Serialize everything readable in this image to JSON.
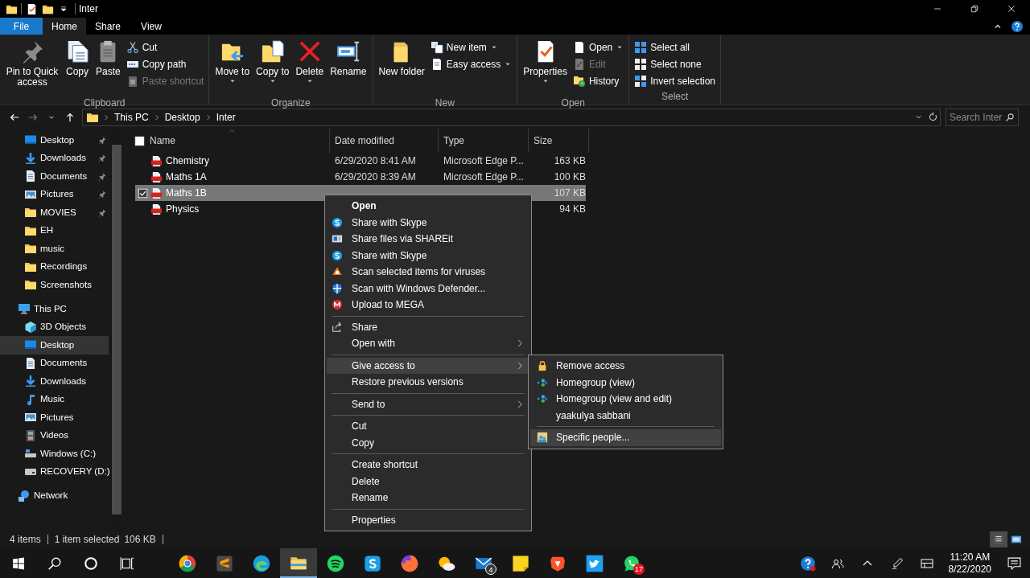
{
  "title_bar": {
    "title": "Inter",
    "quick_access": [
      {
        "kind": "folder"
      },
      {
        "kind": "properties"
      },
      {
        "kind": "folder"
      },
      {
        "kind": "dropdown"
      }
    ],
    "window_controls": [
      {
        "kind": "minimize"
      },
      {
        "kind": "restore"
      },
      {
        "kind": "close"
      }
    ]
  },
  "ribbon_tabs": [
    {
      "label": "File",
      "kind": "file",
      "selected": false
    },
    {
      "label": "Home",
      "kind": "tab",
      "selected": true
    },
    {
      "label": "Share",
      "kind": "tab",
      "selected": false
    },
    {
      "label": "View",
      "kind": "tab",
      "selected": false
    }
  ],
  "ribbon_controls": [
    {
      "kind": "collapse"
    },
    {
      "kind": "help"
    }
  ],
  "ribbon_groups": [
    {
      "label": "Clipboard",
      "commands": [
        {
          "label": "Pin to Quick access",
          "kind": "large",
          "dropdown": false,
          "disabled": false
        },
        {
          "label": "Copy",
          "kind": "large",
          "dropdown": false,
          "disabled": false
        },
        {
          "label": "Paste",
          "kind": "large",
          "dropdown": false,
          "disabled": false
        },
        {
          "label": "Cut",
          "kind": "small",
          "dropdown": false,
          "disabled": false
        },
        {
          "label": "Copy path",
          "kind": "small",
          "dropdown": false,
          "disabled": false
        },
        {
          "label": "Paste shortcut",
          "kind": "small",
          "dropdown": false,
          "disabled": true
        }
      ]
    },
    {
      "label": "Organize",
      "commands": [
        {
          "label": "Move to",
          "kind": "large",
          "dropdown": true,
          "disabled": false
        },
        {
          "label": "Copy to",
          "kind": "large",
          "dropdown": true,
          "disabled": false
        },
        {
          "label": "Delete",
          "kind": "large",
          "dropdown": true,
          "disabled": false
        },
        {
          "label": "Rename",
          "kind": "large",
          "dropdown": false,
          "disabled": false
        }
      ]
    },
    {
      "label": "New",
      "commands": [
        {
          "label": "New folder",
          "kind": "large",
          "dropdown": false,
          "disabled": false
        },
        {
          "label": "New item",
          "kind": "small",
          "dropdown": true,
          "disabled": false
        },
        {
          "label": "Easy access",
          "kind": "small",
          "dropdown": true,
          "disabled": false
        }
      ]
    },
    {
      "label": "Open",
      "commands": [
        {
          "label": "Properties",
          "kind": "large",
          "dropdown": true,
          "disabled": false
        },
        {
          "label": "Open",
          "kind": "small",
          "dropdown": true,
          "disabled": false
        },
        {
          "label": "Edit",
          "kind": "small",
          "dropdown": false,
          "disabled": true
        },
        {
          "label": "History",
          "kind": "small",
          "dropdown": false,
          "disabled": false
        }
      ]
    },
    {
      "label": "Select",
      "commands": [
        {
          "label": "Select all",
          "kind": "small",
          "dropdown": false,
          "disabled": false
        },
        {
          "label": "Select none",
          "kind": "small",
          "dropdown": false,
          "disabled": false
        },
        {
          "label": "Invert selection",
          "kind": "small",
          "dropdown": false,
          "disabled": false
        }
      ]
    }
  ],
  "navigation": {
    "buttons": [
      {
        "kind": "back",
        "disabled": false
      },
      {
        "kind": "forward",
        "disabled": true
      },
      {
        "kind": "recent",
        "disabled": false
      },
      {
        "kind": "up",
        "disabled": false
      }
    ],
    "path": [
      "This PC",
      "Desktop",
      "Inter"
    ],
    "search": {
      "placeholder": "Search Inter"
    }
  },
  "sidebar": {
    "quick_access_items": [
      {
        "label": "Desktop",
        "kind": "desktop",
        "pinned": true,
        "selected": false
      },
      {
        "label": "Downloads",
        "kind": "download",
        "pinned": true,
        "selected": false
      },
      {
        "label": "Documents",
        "kind": "documents",
        "pinned": true,
        "selected": false
      },
      {
        "label": "Pictures",
        "kind": "pictures",
        "pinned": true,
        "selected": false
      },
      {
        "label": "MOVIES",
        "kind": "folder",
        "pinned": true,
        "selected": false
      },
      {
        "label": "EH",
        "kind": "folder",
        "pinned": false,
        "selected": false
      },
      {
        "label": "music",
        "kind": "folder",
        "pinned": false,
        "selected": false
      },
      {
        "label": "Recordings",
        "kind": "folder",
        "pinned": false,
        "selected": false
      },
      {
        "label": "Screenshots",
        "kind": "folder",
        "pinned": false,
        "selected": false
      }
    ],
    "tree": [
      {
        "label": "This PC",
        "kind": "pc",
        "selected": false,
        "children": [
          {
            "label": "3D Objects",
            "kind": "cube",
            "selected": false
          },
          {
            "label": "Desktop",
            "kind": "desktop",
            "selected": true
          },
          {
            "label": "Documents",
            "kind": "documents",
            "selected": false
          },
          {
            "label": "Downloads",
            "kind": "download",
            "selected": false
          },
          {
            "label": "Music",
            "kind": "music",
            "selected": false
          },
          {
            "label": "Pictures",
            "kind": "pictures",
            "selected": false
          },
          {
            "label": "Videos",
            "kind": "videos",
            "selected": false
          },
          {
            "label": "Windows (C:)",
            "kind": "drivec",
            "selected": false
          },
          {
            "label": "RECOVERY (D:)",
            "kind": "drive",
            "selected": false
          }
        ]
      },
      {
        "label": "Network",
        "kind": "network",
        "selected": false
      }
    ]
  },
  "file_list": {
    "header_checkbox": {
      "checked": false
    },
    "columns": [
      "Name",
      "Date modified",
      "Type",
      "Size"
    ],
    "rows": [
      {
        "name": "Chemistry",
        "date": "6/29/2020 8:41 AM",
        "type": "Microsoft Edge P...",
        "size": "163 KB",
        "selected": false,
        "checked": false
      },
      {
        "name": "Maths 1A",
        "date": "6/29/2020 8:39 AM",
        "type": "Microsoft Edge P...",
        "size": "100 KB",
        "selected": false,
        "checked": false
      },
      {
        "name": "Maths 1B",
        "size": "107 KB",
        "selected": true,
        "checked": true
      },
      {
        "name": "Physics",
        "size": "94 KB",
        "selected": false,
        "checked": false
      }
    ]
  },
  "context_menu": {
    "groups": [
      [
        {
          "label": "Open",
          "kind": "plain",
          "default": true,
          "submenu": false,
          "selected": false
        },
        {
          "label": "Share with Skype",
          "kind": "skype",
          "default": false,
          "submenu": false,
          "selected": false
        },
        {
          "label": "Share files via SHAREit",
          "kind": "shareit",
          "default": false,
          "submenu": false,
          "selected": false
        },
        {
          "label": "Share with Skype",
          "kind": "skype",
          "default": false,
          "submenu": false,
          "selected": false
        },
        {
          "label": "Scan selected items for viruses",
          "kind": "avast",
          "default": false,
          "submenu": false,
          "selected": false
        },
        {
          "label": "Scan with Windows Defender...",
          "kind": "defender",
          "default": false,
          "submenu": false,
          "selected": false
        },
        {
          "label": "Upload to MEGA",
          "kind": "mega",
          "default": false,
          "submenu": false,
          "selected": false
        }
      ],
      [
        {
          "label": "Share",
          "kind": "share",
          "default": false,
          "submenu": false,
          "selected": false
        },
        {
          "label": "Open with",
          "kind": "plain",
          "default": false,
          "submenu": true,
          "selected": false
        }
      ],
      [
        {
          "label": "Give access to",
          "kind": "plain",
          "default": false,
          "submenu": true,
          "selected": true
        },
        {
          "label": "Restore previous versions",
          "kind": "plain",
          "default": false,
          "submenu": false,
          "selected": false
        }
      ],
      [
        {
          "label": "Send to",
          "kind": "plain",
          "default": false,
          "submenu": true,
          "selected": false
        }
      ],
      [
        {
          "label": "Cut",
          "kind": "plain",
          "default": false,
          "submenu": false,
          "selected": false
        },
        {
          "label": "Copy",
          "kind": "plain",
          "default": false,
          "submenu": false,
          "selected": false
        }
      ],
      [
        {
          "label": "Create shortcut",
          "kind": "plain",
          "default": false,
          "submenu": false,
          "selected": false
        },
        {
          "label": "Delete",
          "kind": "plain",
          "default": false,
          "submenu": false,
          "selected": false
        },
        {
          "label": "Rename",
          "kind": "plain",
          "default": false,
          "submenu": false,
          "selected": false
        }
      ],
      [
        {
          "label": "Properties",
          "kind": "plain",
          "default": false,
          "submenu": false,
          "selected": false
        }
      ]
    ]
  },
  "give_access_submenu": {
    "groups": [
      [
        {
          "label": "Remove access",
          "kind": "lock",
          "selected": false
        },
        {
          "label": "Homegroup (view)",
          "kind": "homegroup",
          "selected": false
        },
        {
          "label": "Homegroup (view and edit)",
          "kind": "homegroup",
          "selected": false
        },
        {
          "label": "yaakulya sabbani",
          "kind": "plain",
          "selected": false
        }
      ],
      [
        {
          "label": "Specific people...",
          "kind": "people",
          "selected": true
        }
      ]
    ]
  },
  "status_bar": {
    "item_count": "4 items",
    "selection": "1 item selected",
    "selection_size": "106 KB",
    "view_buttons": [
      {
        "kind": "details",
        "selected": true
      },
      {
        "kind": "tiles",
        "selected": false
      }
    ]
  },
  "taskbar": {
    "buttons": [
      {
        "kind": "start"
      },
      {
        "kind": "search"
      },
      {
        "kind": "cortana"
      },
      {
        "kind": "taskview"
      }
    ],
    "apps": [
      {
        "kind": "chrome",
        "selected": false
      },
      {
        "kind": "sublime",
        "selected": false
      },
      {
        "kind": "edge",
        "selected": false
      },
      {
        "kind": "explorer",
        "selected": true
      },
      {
        "kind": "spotify",
        "selected": false
      },
      {
        "kind": "skype",
        "selected": false
      },
      {
        "kind": "firefox",
        "selected": false
      },
      {
        "kind": "weather",
        "selected": false
      },
      {
        "kind": "mail",
        "selected": false,
        "badge": "4"
      },
      {
        "kind": "sticky",
        "selected": false
      },
      {
        "kind": "brave",
        "selected": false
      },
      {
        "kind": "twitter",
        "selected": false
      },
      {
        "kind": "whatsapp",
        "selected": false,
        "badge": "17"
      }
    ],
    "tray": [
      {
        "kind": "help"
      },
      {
        "kind": "people"
      },
      {
        "kind": "caret"
      },
      {
        "kind": "pen"
      },
      {
        "kind": "keyboard"
      }
    ],
    "time": "11:20 AM",
    "date": "8/22/2020",
    "tray_end": [
      {
        "kind": "notifications"
      }
    ]
  }
}
